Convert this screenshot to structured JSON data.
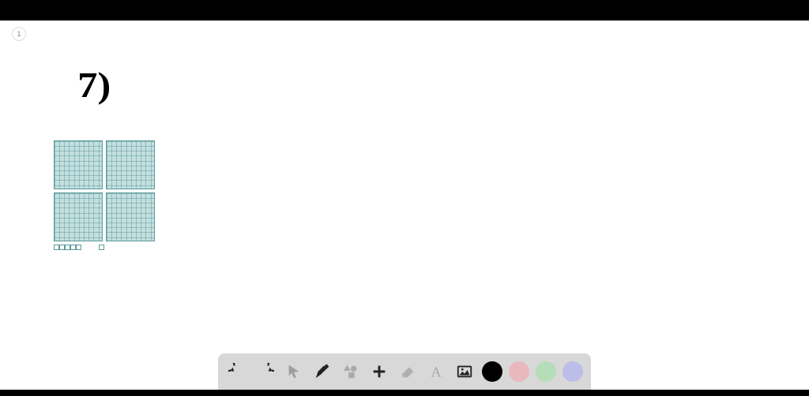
{
  "page": {
    "badge": "1",
    "handwritten_label": "7)"
  },
  "blocks": {
    "hundreds_rows": 2,
    "hundreds_cols": 2,
    "ones_group_a": 5,
    "ones_group_b": 1,
    "block_color": "#c4dfdf",
    "block_line_color": "#5a9a9a"
  },
  "toolbar": {
    "undo": "Undo",
    "redo": "Redo",
    "pointer": "Pointer",
    "pen": "Pen",
    "shapes": "Shapes",
    "add": "Add",
    "eraser": "Eraser",
    "text": "Text",
    "image": "Image"
  },
  "colors": {
    "black": "#000000",
    "pink": "#e9b8bd",
    "green": "#b5deb8",
    "purple": "#bcbde9"
  }
}
